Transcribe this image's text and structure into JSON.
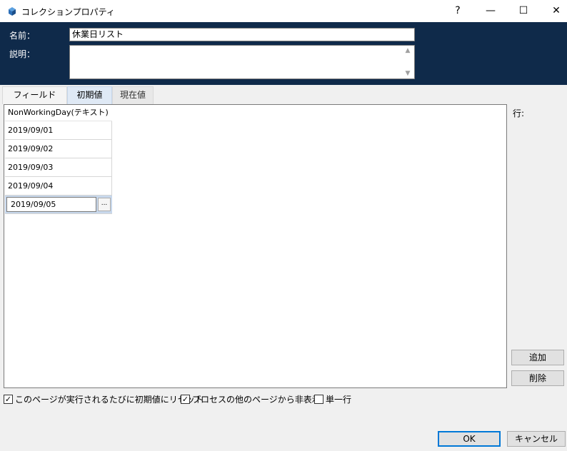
{
  "window": {
    "title": "コレクションプロパティ",
    "help": "?",
    "minimize": "—",
    "maximize": "☐",
    "close": "✕"
  },
  "header": {
    "name_label": "名前：",
    "name_value": "休業日リスト",
    "description_label": "説明：",
    "description_value": ""
  },
  "tabs": [
    {
      "label": "フィールド"
    },
    {
      "label": "初期値"
    },
    {
      "label": "現在値"
    }
  ],
  "grid": {
    "column_header": "NonWorkingDay(テキスト)",
    "rows": [
      "2019/09/01",
      "2019/09/02",
      "2019/09/03",
      "2019/09/04"
    ],
    "editing_value": "2019/09/05",
    "ellipsis_button": "..."
  },
  "side_panel": {
    "row_label": "行:",
    "add_button": "追加",
    "delete_button": "削除"
  },
  "options": {
    "reset_label": "このページが実行されるたびに初期値にリセット",
    "reset_checked": true,
    "hide_label": "プロセスの他のページから非表示",
    "hide_checked": true,
    "single_row_label": "単一行",
    "single_row_checked": false,
    "check_mark": "✓"
  },
  "footer": {
    "ok_button": "OK",
    "cancel_button": "キャンセル"
  },
  "colors": {
    "header_bg": "#0f2a4a",
    "selected_tab": "#dfe9f5",
    "edit_row": "#c8d8ec",
    "ok_border": "#0078d7"
  }
}
